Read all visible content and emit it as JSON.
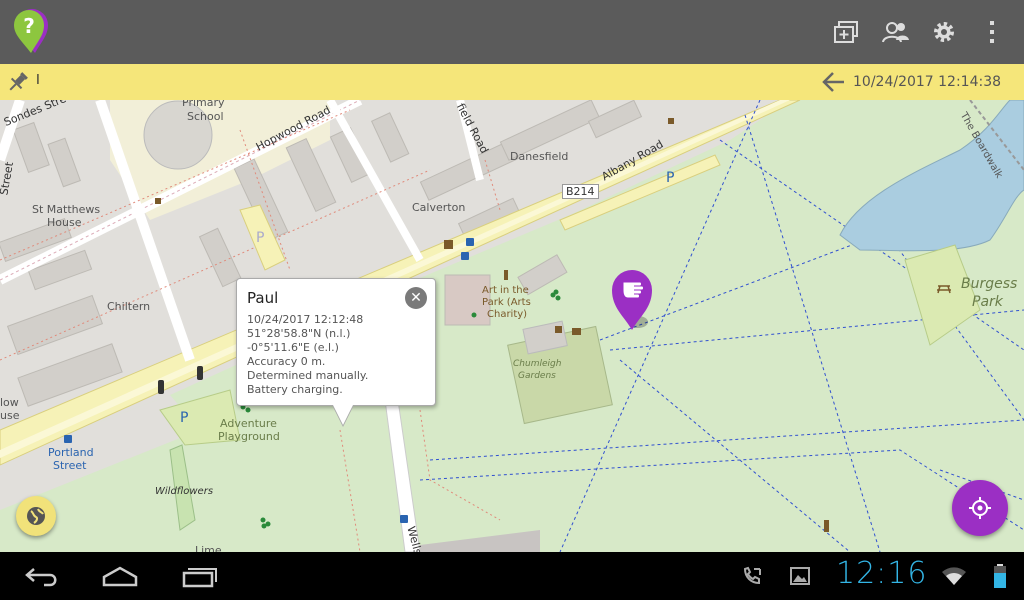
{
  "app": {
    "logo_icon": "question-pin-logo",
    "accent": "#9b2fc4",
    "logo_green": "#8dc63f"
  },
  "actionbar": {
    "icons": [
      "add-layer-icon",
      "people-icon",
      "gear-icon",
      "overflow-menu-icon"
    ]
  },
  "infobar": {
    "pin_icon": "pin-icon",
    "text": "I",
    "back_icon": "back-arrow-icon",
    "timestamp": "10/24/2017 12:14:38"
  },
  "map": {
    "labels": {
      "sondes": "Sondes Stre",
      "primary_school": "Primary",
      "primary_school2": "School",
      "hopwood": "Hopwood Road",
      "field_road": "field Road",
      "danesfield": "Danesfield",
      "albany": "Albany Road",
      "b214": "B214",
      "street": "Street",
      "st_matthews": "St Matthews",
      "st_matthews2": "House",
      "calverton": "Calverton",
      "chiltern": "Chiltern",
      "art_park": "Art in the",
      "art_park2": "Park (Arts",
      "art_park3": "Charity)",
      "chumleigh": "Chumleigh",
      "chumleigh2": "Gardens",
      "burgess": "Burgess",
      "burgess2": "Park",
      "boardwalk": "The Boardwalk",
      "adventure": "Adventure",
      "adventure2": "Playground",
      "portland": "Portland",
      "portland2": "Street",
      "wildflowers": "Wildflowers",
      "lime": "Lime",
      "wells": "Wells",
      "low": "low",
      "use": "use"
    }
  },
  "popup": {
    "name": "Paul",
    "lines": [
      "10/24/2017 12:12:48",
      "51°28'58.8\"N (n.l.)",
      "-0°5'11.6\"E (e.l.)",
      "Accuracy 0 m.",
      "Determined manually.",
      "Battery charging."
    ],
    "close_icon": "close-icon"
  },
  "marker": {
    "icon": "pointing-hand-marker-icon",
    "color": "#9b2fc4"
  },
  "fabs": {
    "globe_icon": "globe-icon",
    "locate_icon": "crosshair-icon"
  },
  "system": {
    "clock": "12:16",
    "clock_color": "#33b5e5",
    "nav_icons": [
      "back-icon",
      "home-icon",
      "recent-apps-icon"
    ],
    "status_icons": [
      "phone-icon",
      "gallery-icon",
      "wifi-icon",
      "battery-icon"
    ]
  }
}
